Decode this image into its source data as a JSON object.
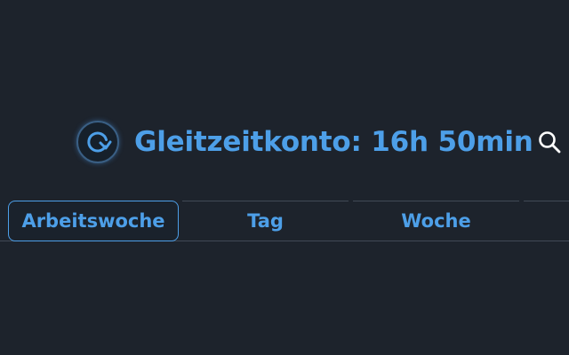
{
  "header": {
    "title": "Gleitzeitkonto: 16h 50min",
    "refresh_icon": "refresh-icon",
    "search_icon": "search-icon"
  },
  "tabs": [
    {
      "label": "Arbeitswoche",
      "active": true
    },
    {
      "label": "Tag",
      "active": false
    },
    {
      "label": "Woche",
      "active": false
    }
  ],
  "colors": {
    "background": "#1d232c",
    "accent": "#4d9fe8",
    "divider": "#414a56"
  }
}
